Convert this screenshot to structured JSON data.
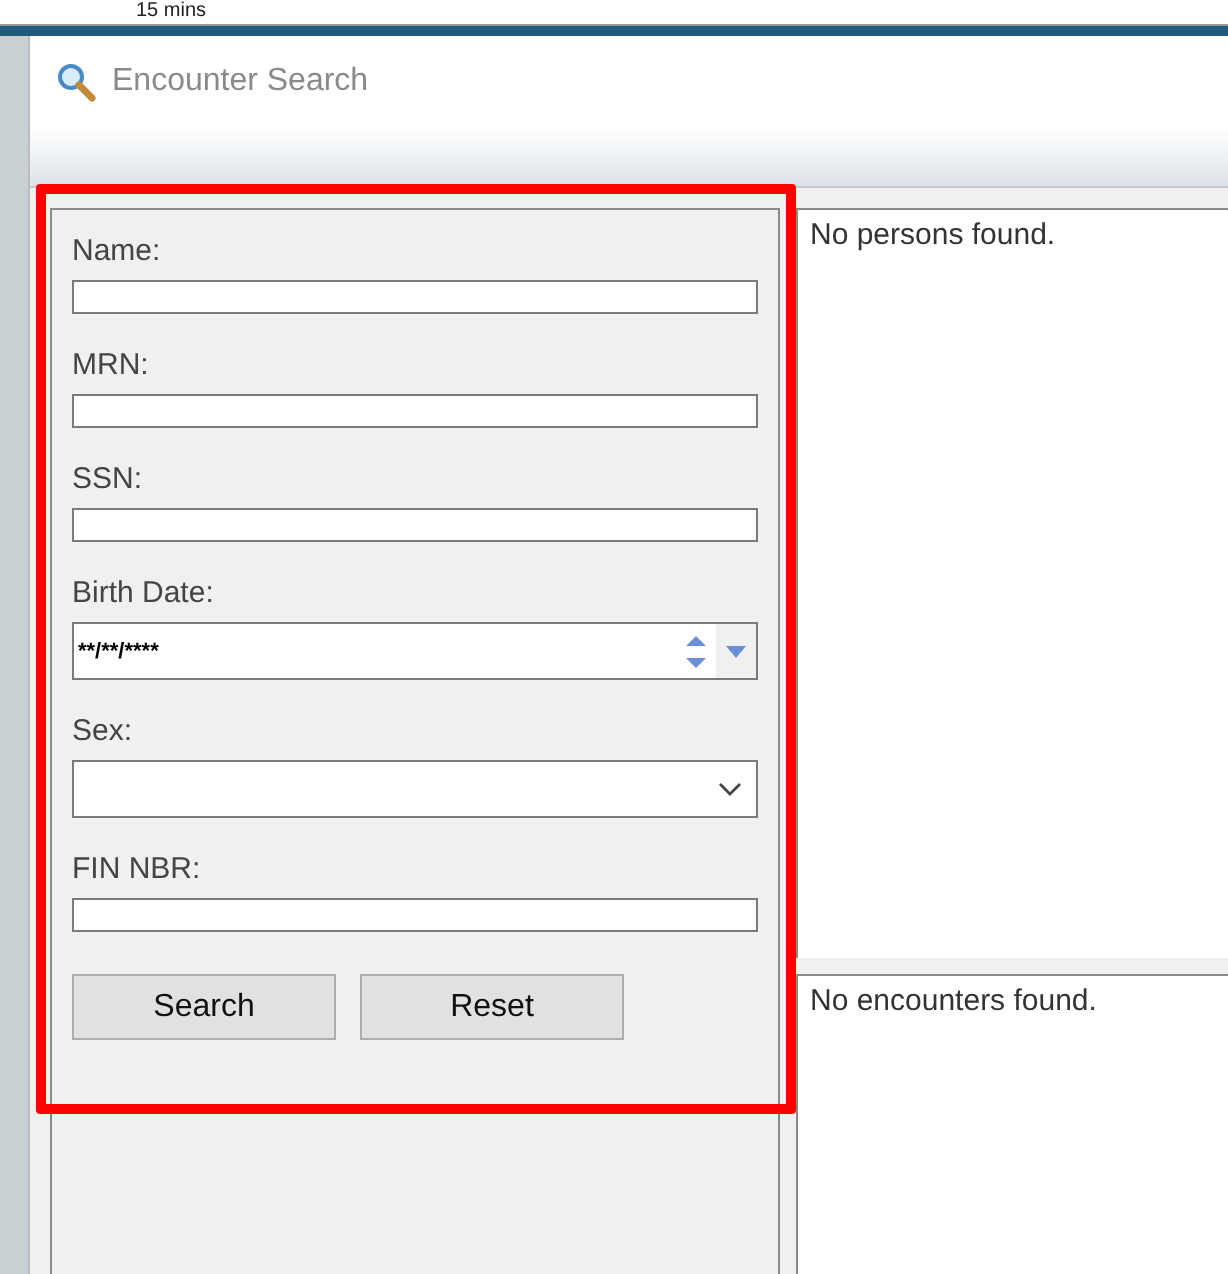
{
  "background": {
    "text": "15 mins"
  },
  "window": {
    "title": "Encounter Search"
  },
  "fields": [
    {
      "kind": "text",
      "label": "Name:"
    },
    {
      "kind": "text",
      "label": "MRN:"
    },
    {
      "kind": "text",
      "label": "SSN:"
    },
    {
      "kind": "date",
      "label": "Birth Date:",
      "value": "**/**/****"
    },
    {
      "kind": "select",
      "label": "Sex:"
    },
    {
      "kind": "text",
      "label": "FIN NBR:"
    }
  ],
  "buttons": [
    "Search",
    "Reset"
  ],
  "persons_pane": {
    "message": "No persons found."
  },
  "encounters_pane": {
    "message": "No encounters found."
  }
}
